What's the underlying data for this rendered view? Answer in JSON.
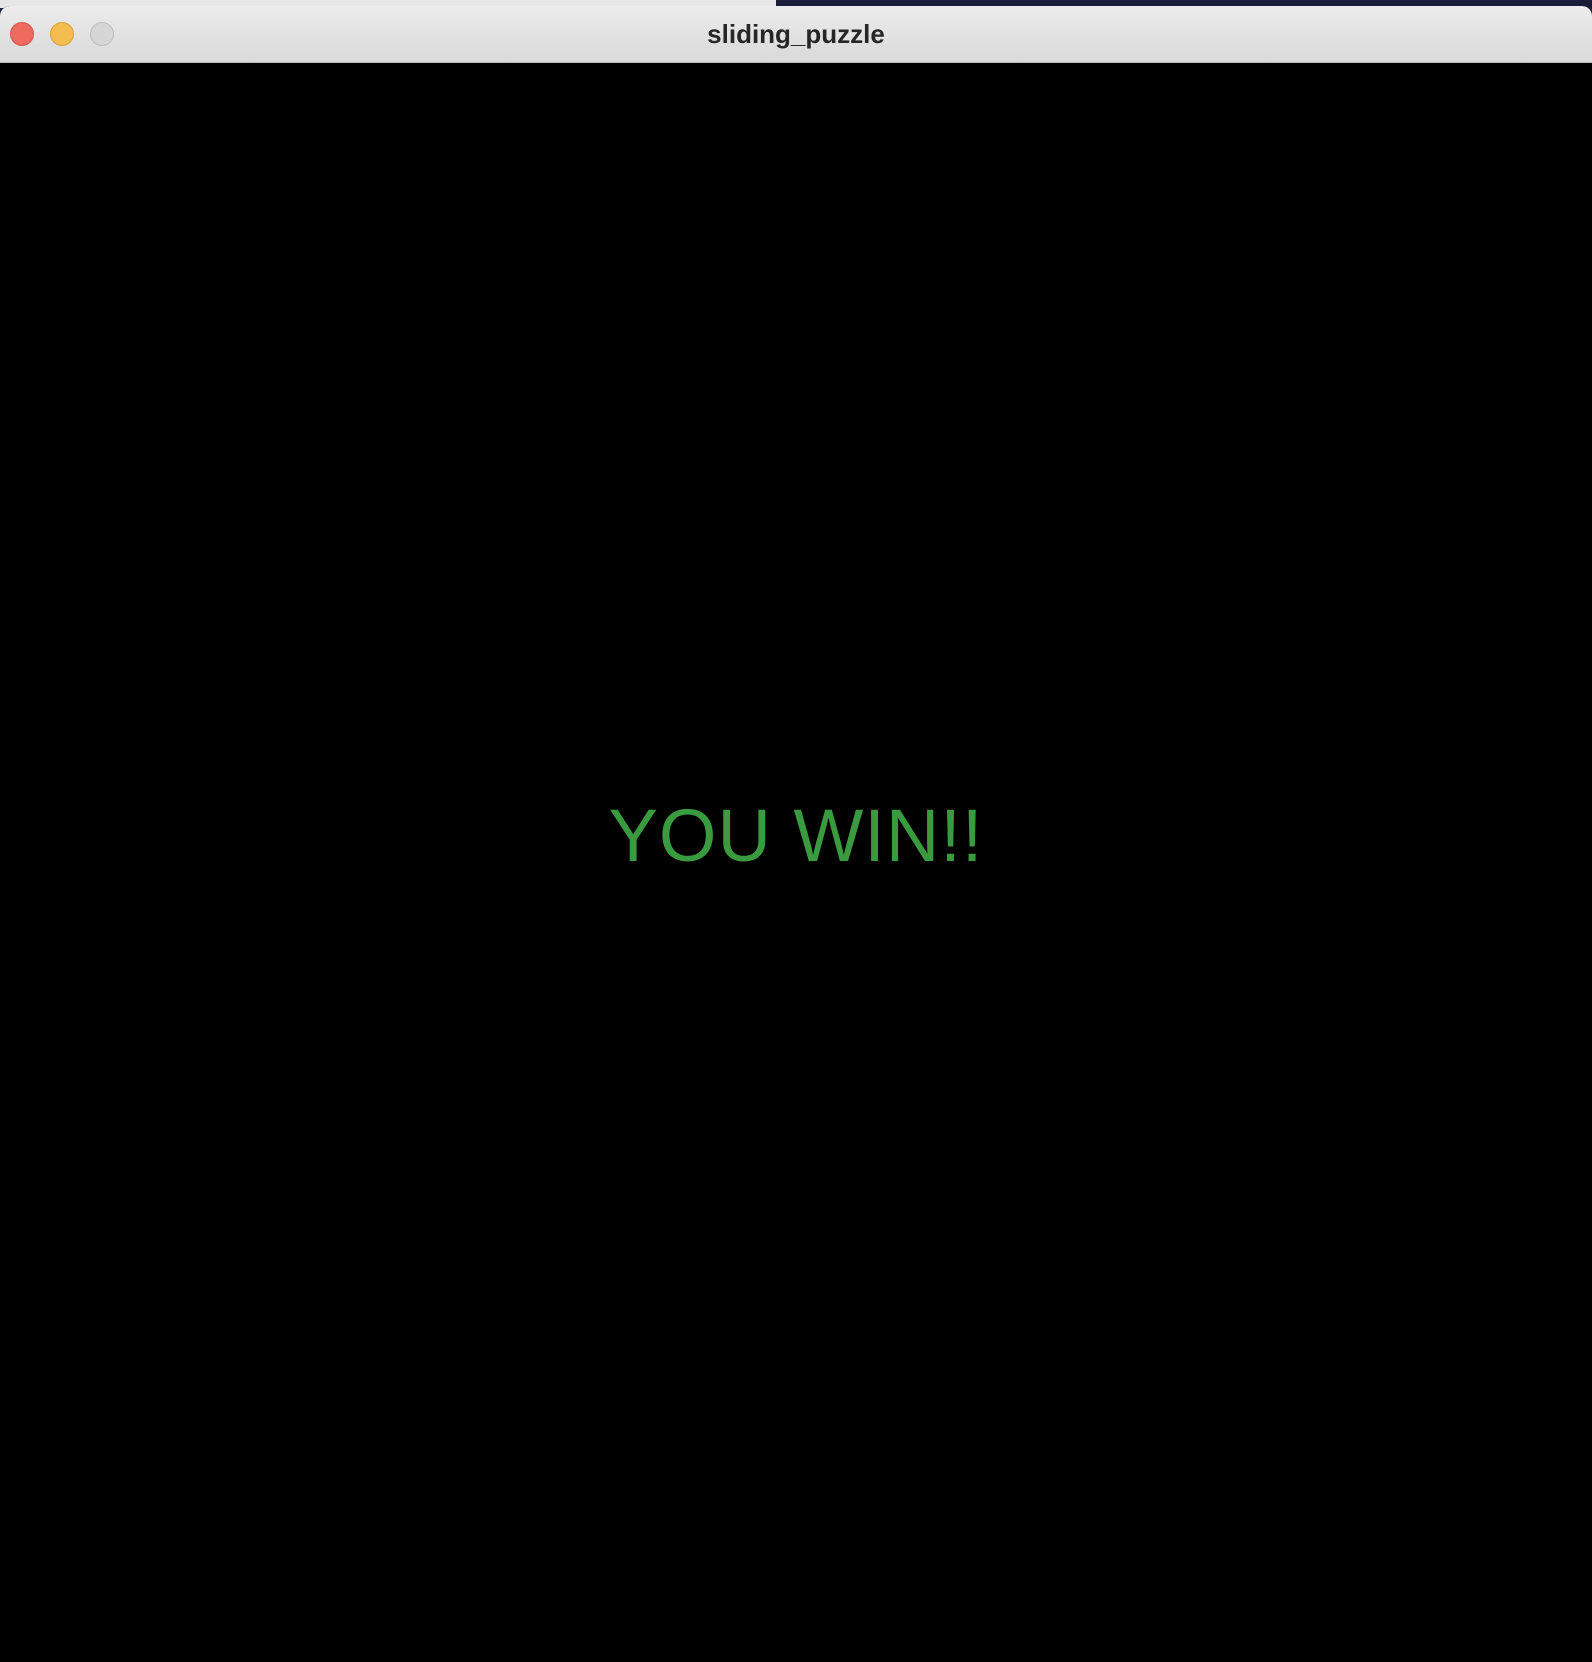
{
  "window": {
    "title": "sliding_puzzle",
    "controls": [
      "close-icon",
      "minimize-icon",
      "zoom-icon"
    ]
  },
  "game": {
    "message": "YOU WIN!!",
    "message_color": "#3a9a3f",
    "background_color": "#000000"
  }
}
